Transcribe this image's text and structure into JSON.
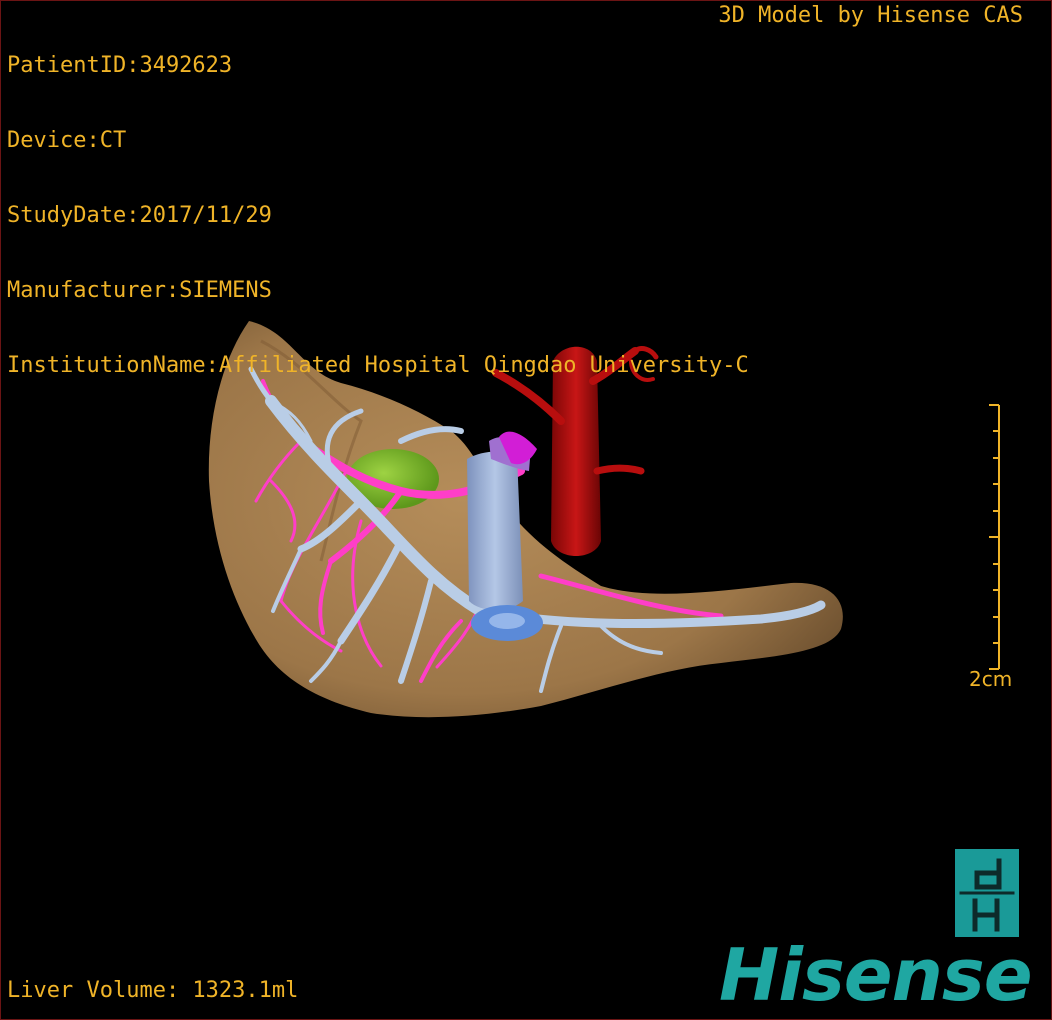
{
  "header_info": {
    "patient_id": "PatientID:3492623",
    "device": "Device:CT",
    "study_date": "StudyDate:2017/11/29",
    "manufacturer": "Manufacturer:SIEMENS",
    "institution": "InstitutionName:Affiliated Hospital Qingdao University-C"
  },
  "title": "3D Model by Hisense CAS",
  "scale": {
    "label": "2cm"
  },
  "footer": {
    "liver_volume": "Liver Volume: 1323.1ml"
  },
  "logo": {
    "word": "Hisense",
    "badge_icon": "dH-logo-icon"
  },
  "colors": {
    "overlay_text": "#f0b428",
    "liver": "#a07a4c",
    "portal_vein": "#b9cde6",
    "hepatic_artery": "#ff3ec8",
    "aorta": "#b80e0e",
    "ivc": "#9fb4d8",
    "gallbladder": "#6fc41e",
    "brand": "#1fa7a2",
    "frame": "#6b1414"
  }
}
